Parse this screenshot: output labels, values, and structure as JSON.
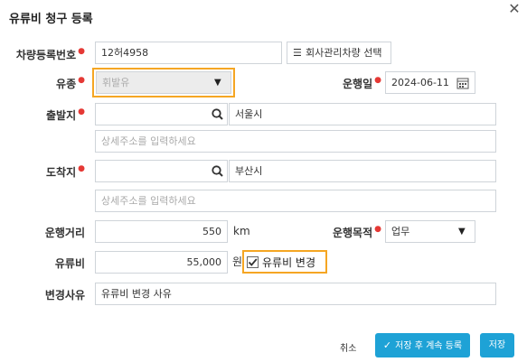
{
  "dialog": {
    "title": "유류비 청구 등록"
  },
  "form": {
    "vehicle_number": {
      "label": "차량등록번호",
      "value": "12허4958"
    },
    "company_vehicle_button": "회사관리차량 선택",
    "fuel_type": {
      "label": "유종",
      "value": "휘발유"
    },
    "drive_date": {
      "label": "운행일",
      "value": "2024-06-11"
    },
    "departure": {
      "label": "출발지",
      "search_value": "",
      "city": "서울시",
      "detail_placeholder": "상세주소를 입력하세요"
    },
    "arrival": {
      "label": "도착지",
      "search_value": "",
      "city": "부산시",
      "detail_placeholder": "상세주소를 입력하세요"
    },
    "distance": {
      "label": "운행거리",
      "value": "550",
      "unit": "km"
    },
    "purpose": {
      "label": "운행목적",
      "value": "업무"
    },
    "fuel_cost": {
      "label": "유류비",
      "value": "55,000",
      "unit": "원",
      "change_checkbox_label": "유류비 변경",
      "change_checked": true
    },
    "change_reason": {
      "label": "변경사유",
      "value": "유류비 변경 사유"
    }
  },
  "footer": {
    "cancel": "취소",
    "save_continue": "저장 후 계속 등록",
    "save": "저장"
  },
  "colors": {
    "primary": "#1ea2d6",
    "highlight": "#f5a623",
    "required": "#e53935"
  }
}
